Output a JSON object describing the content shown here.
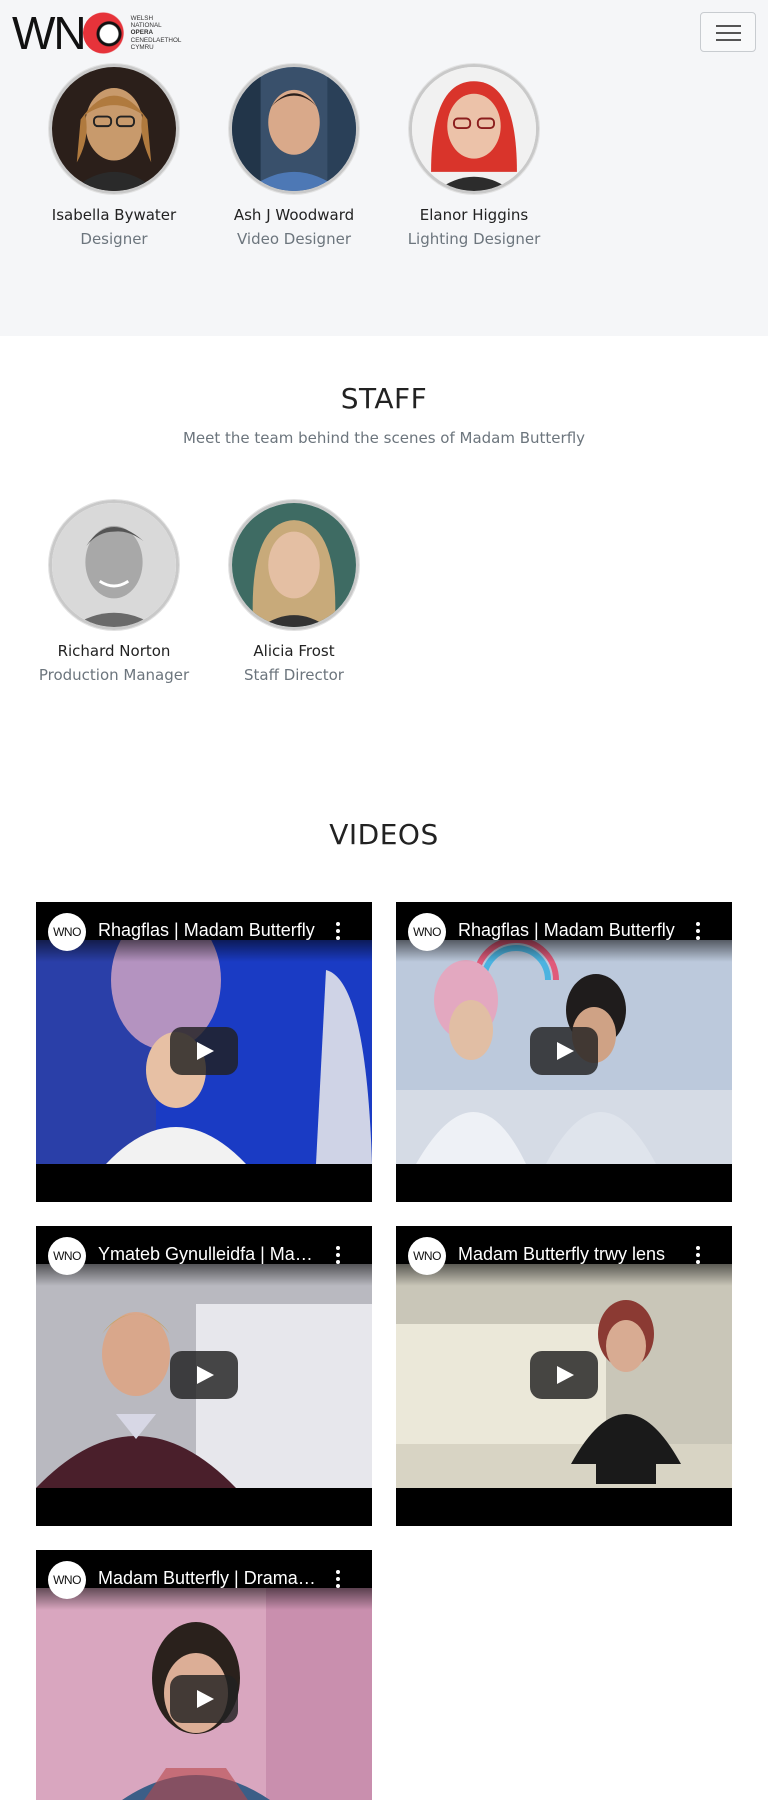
{
  "header": {
    "logo_text": "WNO",
    "logo_lines": [
      "WELSH",
      "NATIONAL",
      "OPERA",
      "CENEDLAETHOL",
      "CYMRU"
    ],
    "menu_icon": "hamburger-menu-icon"
  },
  "creative_team": [
    {
      "name": "Isabella Bywater",
      "role": "Designer"
    },
    {
      "name": "Ash J Woodward",
      "role": "Video Designer"
    },
    {
      "name": "Elanor Higgins",
      "role": "Lighting Designer"
    }
  ],
  "staff": {
    "title": "STAFF",
    "subtitle": "Meet the team behind the scenes of Madam Butterfly",
    "members": [
      {
        "name": "Richard Norton",
        "role": "Production Manager"
      },
      {
        "name": "Alicia Frost",
        "role": "Staff Director"
      }
    ]
  },
  "videos": {
    "title": "VIDEOS",
    "channel_logo": "WNO",
    "items": [
      {
        "title": "Rhagflas | Madam Butterfly"
      },
      {
        "title": "Rhagflas | Madam Butterfly"
      },
      {
        "title": "Ymateb Gynulleidfa | Madam Butterfly"
      },
      {
        "title": "Madam Butterfly trwy lens"
      },
      {
        "title": "Madam Butterfly | Dramaturgy"
      }
    ]
  },
  "colors": {
    "brand_red": "#e6333a",
    "section_grey": "#f5f6f8",
    "muted_text": "#6c757d"
  }
}
